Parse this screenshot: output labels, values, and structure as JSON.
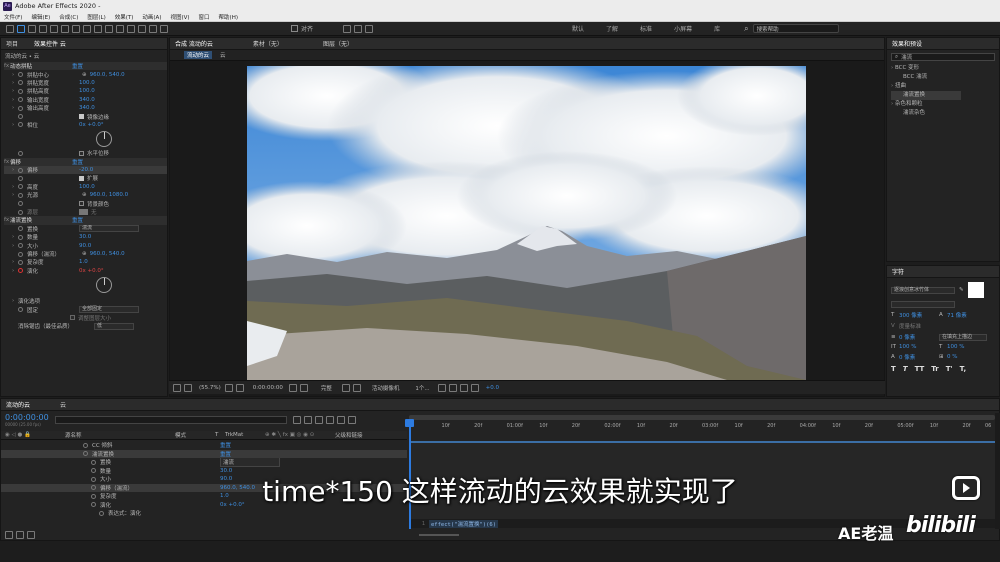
{
  "app": {
    "title": "Adobe After Effects 2020 -"
  },
  "menu": [
    "文件(F)",
    "编辑(E)",
    "合成(C)",
    "图层(L)",
    "效果(T)",
    "动画(A)",
    "视图(V)",
    "窗口",
    "帮助(H)"
  ],
  "toolbar": {
    "align": "对齐",
    "workspaces": [
      "默认",
      "了解",
      "标准",
      "小屏幕",
      "库"
    ],
    "search_placeholder": "搜索帮助"
  },
  "left_panel": {
    "tabs": [
      "项目",
      "效果控件 云"
    ],
    "layer_path": "流动的云 • 云",
    "effects": [
      {
        "name": "动态拼贴",
        "reset": "重置",
        "props": [
          {
            "name": "拼贴中心",
            "value": "960.0, 540.0"
          },
          {
            "name": "拼贴宽度",
            "value": "100.0"
          },
          {
            "name": "拼贴高度",
            "value": "100.0"
          },
          {
            "name": "输出宽度",
            "value": "340.0"
          },
          {
            "name": "输出高度",
            "value": "340.0"
          }
        ],
        "mirror_label": "镜像边缘",
        "phase_name": "相位",
        "phase_value": "0x +0.0°",
        "hshift_label": "水平位移"
      },
      {
        "name": "偏移",
        "reset": "重置",
        "props": [
          {
            "name": "偏移",
            "value": "-20.0"
          },
          {
            "name": "扩展",
            "value": "100.0"
          },
          {
            "name": "高度",
            "value": "100.0"
          },
          {
            "name": "光源",
            "value": "960.0, 1080.0"
          }
        ],
        "fill_label": "扩展",
        "bg_label": "背景颜色",
        "source_label": "源层",
        "source_value": "无"
      },
      {
        "name": "湍流置换",
        "reset": "重置",
        "props": [
          {
            "name": "置换",
            "value": "湍流"
          },
          {
            "name": "数量",
            "value": "30.0"
          },
          {
            "name": "大小",
            "value": "90.0"
          },
          {
            "name": "偏移（湍流）",
            "value": "960.0, 540.0"
          },
          {
            "name": "复杂度",
            "value": "1.0"
          },
          {
            "name": "演化",
            "value": "0x +0.0°"
          }
        ],
        "evolution_options": "演化选项",
        "pin_name": "固定",
        "pin_value": "全部固定",
        "resize_label": "调整图层大小",
        "antialias_name": "消除锯齿（最佳品质）",
        "antialias_value": "低"
      }
    ]
  },
  "viewer": {
    "tabs": [
      "合成 流动的云",
      "素材（无）",
      "图层（无）"
    ],
    "subtabs": [
      "流动的云",
      "云"
    ],
    "zoom": "(55.7%)",
    "timecode": "0:00:00:00",
    "quality": "完整",
    "camera": "活动摄像机",
    "views": "1个...",
    "exposure": "+0.0"
  },
  "right_panel": {
    "effects_tab": "效果和预设",
    "search_value": "湍流",
    "tree": [
      {
        "label": "BCC 变形",
        "indent": 0
      },
      {
        "label": "BCC 湍流",
        "indent": 2
      },
      {
        "label": "扭曲",
        "indent": 0
      },
      {
        "label": "湍流置换",
        "indent": 2
      },
      {
        "label": "杂色和颗粒",
        "indent": 0
      },
      {
        "label": "湍流杂色",
        "indent": 2
      }
    ],
    "char_tab": "字符",
    "font": "逐浪创意冰竹体",
    "size": "300 像素",
    "leading": "71 像素",
    "tracking_label": "度量标准",
    "stroke": "0 像素",
    "stroke_mode": "在填充上描边",
    "vscale": "100 %",
    "hscale": "100 %",
    "baseline": "0 像素",
    "tsume": "0 %",
    "styles": [
      "T",
      "T",
      "TT",
      "Tr",
      "T'",
      "T,"
    ]
  },
  "timeline": {
    "tabs": [
      "流动的云",
      "云"
    ],
    "timecode": "0:00:00:00",
    "timecode_sub": "00000 (25.00 fps)",
    "cols": {
      "source": "源名称",
      "mode": "模式",
      "t": "T",
      "trkmat": "TrkMat",
      "parent": "父级和链接"
    },
    "ruler": [
      "0f",
      "10f",
      "20f",
      "01:00f",
      "10f",
      "20f",
      "02:00f",
      "10f",
      "20f",
      "03:00f",
      "10f",
      "20f",
      "04:00f",
      "10f",
      "20f",
      "05:00f",
      "10f",
      "20f",
      "06"
    ],
    "rows": [
      {
        "indent": 22,
        "name": "CC 倾斜",
        "value": "重置",
        "kind": "text"
      },
      {
        "indent": 22,
        "name": "湍流置换",
        "value": "重置",
        "kind": "text",
        "sel": true
      },
      {
        "indent": 30,
        "name": "置换",
        "value": "湍流",
        "kind": "dd"
      },
      {
        "indent": 30,
        "name": "数量",
        "value": "30.0",
        "kind": "num"
      },
      {
        "indent": 30,
        "name": "大小",
        "value": "90.0",
        "kind": "num"
      },
      {
        "indent": 30,
        "name": "偏移（湍流）",
        "value": "960.0, 540.0",
        "kind": "num",
        "sel": true
      },
      {
        "indent": 30,
        "name": "复杂度",
        "value": "1.0",
        "kind": "num"
      },
      {
        "indent": 30,
        "name": "演化",
        "value": "0x +0.0°",
        "kind": "num"
      },
      {
        "indent": 38,
        "name": "表达式：演化",
        "value": "",
        "kind": "text"
      }
    ],
    "expression": "effect(\"湍流置换\")(6)",
    "line_no": "1"
  },
  "subtitle": "time*150 这样流动的云效果就实现了",
  "watermark": "AE老温",
  "platform": "bilibili",
  "colors": {
    "accent": "#3f8fe0",
    "selection": "#3a3a3a",
    "timeline_cti": "#2d7be0"
  }
}
